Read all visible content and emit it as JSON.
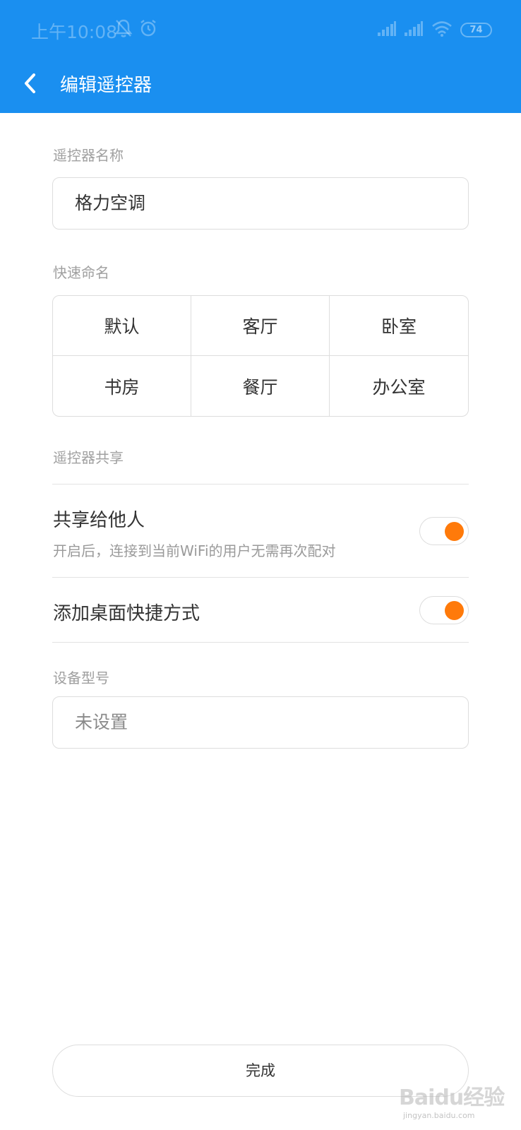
{
  "status_bar": {
    "time": "上午10:08",
    "battery": "74",
    "icons": [
      "mute-bell-icon",
      "alarm-icon",
      "signal-icon",
      "signal-icon",
      "wifi-icon",
      "battery-icon"
    ]
  },
  "header": {
    "back_icon": "chevron-left-icon",
    "title": "编辑遥控器"
  },
  "name_section": {
    "label": "遥控器名称",
    "value": "格力空调"
  },
  "quick_naming": {
    "label": "快速命名",
    "options": [
      "默认",
      "客厅",
      "卧室",
      "书房",
      "餐厅",
      "办公室"
    ]
  },
  "sharing": {
    "label": "遥控器共享",
    "share_title": "共享给他人",
    "share_desc": "开启后，连接到当前WiFi的用户无需再次配对",
    "share_enabled": true,
    "shortcut_title": "添加桌面快捷方式",
    "shortcut_enabled": true
  },
  "device_model": {
    "label": "设备型号",
    "placeholder": "未设置"
  },
  "done_label": "完成",
  "watermark": {
    "logo": "Baidu经验",
    "url": "jingyan.baidu.com"
  },
  "colors": {
    "header": "#1a8ff0",
    "toggle_knob": "#ff7a0a"
  }
}
